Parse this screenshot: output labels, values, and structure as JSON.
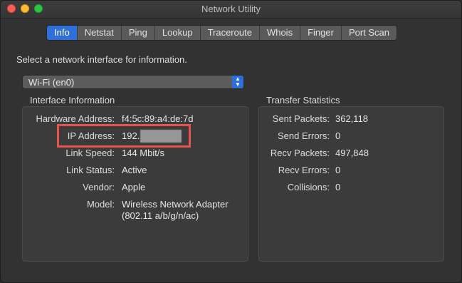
{
  "window": {
    "title": "Network Utility"
  },
  "tabs": [
    {
      "label": "Info",
      "active": true
    },
    {
      "label": "Netstat",
      "active": false
    },
    {
      "label": "Ping",
      "active": false
    },
    {
      "label": "Lookup",
      "active": false
    },
    {
      "label": "Traceroute",
      "active": false
    },
    {
      "label": "Whois",
      "active": false
    },
    {
      "label": "Finger",
      "active": false
    },
    {
      "label": "Port Scan",
      "active": false
    }
  ],
  "prompt": "Select a network interface for information.",
  "interface_select": {
    "value": "Wi-Fi (en0)"
  },
  "interface_info": {
    "title": "Interface Information",
    "rows": [
      {
        "label": "Hardware Address:",
        "value": "f4:5c:89:a4:de:7d"
      },
      {
        "label": "IP Address:",
        "value": "192."
      },
      {
        "label": "Link Speed:",
        "value": "144 Mbit/s"
      },
      {
        "label": "Link Status:",
        "value": "Active"
      },
      {
        "label": "Vendor:",
        "value": "Apple"
      },
      {
        "label": "Model:",
        "value": "Wireless Network Adapter",
        "value2": "(802.11 a/b/g/n/ac)"
      }
    ]
  },
  "transfer_stats": {
    "title": "Transfer Statistics",
    "rows": [
      {
        "label": "Sent Packets:",
        "value": "362,118"
      },
      {
        "label": "Send Errors:",
        "value": "0"
      },
      {
        "label": "Recv Packets:",
        "value": "497,848"
      },
      {
        "label": "Recv Errors:",
        "value": "0"
      },
      {
        "label": "Collisions:",
        "value": "0"
      }
    ]
  },
  "colors": {
    "accent": "#2f6fd8",
    "highlight": "#e5534b"
  }
}
